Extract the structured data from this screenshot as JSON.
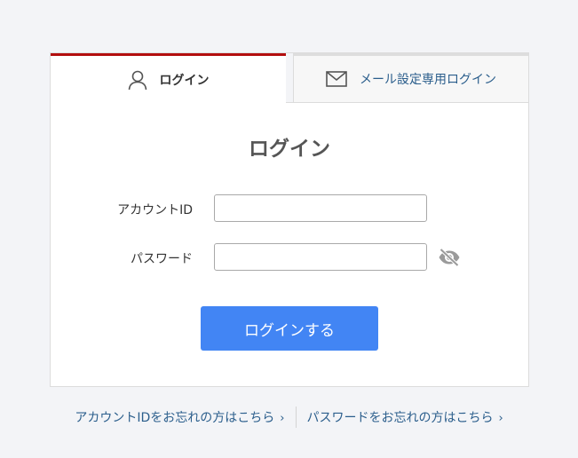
{
  "tabs": {
    "login_label": "ログイン",
    "mail_login_label": "メール設定専用ログイン",
    "login_icon": "user-icon",
    "mail_icon": "envelope-icon"
  },
  "form": {
    "title": "ログイン",
    "account_label": "アカウントID",
    "account_value": "",
    "password_label": "パスワード",
    "password_value": "",
    "password_toggle_icon": "eye-slash-icon",
    "submit_label": "ログインする"
  },
  "links": {
    "forgot_account": "アカウントIDをお忘れの方はこちら",
    "forgot_password": "パスワードをお忘れの方はこちら",
    "chevron": "›"
  },
  "colors": {
    "active_tab_accent": "#b30e0e",
    "submit_button": "#4285f4",
    "link": "#2b5e8c",
    "background": "#f3f4f7"
  }
}
